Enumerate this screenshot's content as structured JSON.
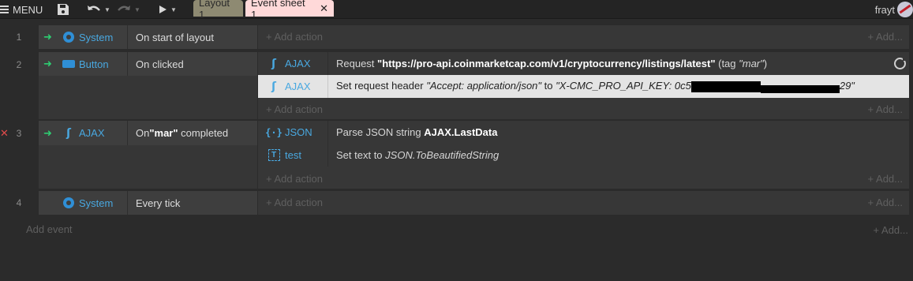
{
  "topbar": {
    "menu_label": "MENU",
    "tabs": [
      "Layout 1",
      "Event sheet 1"
    ],
    "close_glyph": "✕",
    "user_name": "frayt"
  },
  "sheet": {
    "add_action": "+ Add action",
    "add_more": "+ Add...",
    "add_event": "Add event",
    "events": [
      {
        "number": "1",
        "object": "System",
        "icon": "gear-icon",
        "condition": "On start of layout"
      },
      {
        "number": "2",
        "object": "Button",
        "icon": "button-icon",
        "condition": "On clicked",
        "actions": [
          {
            "object": "AJAX",
            "icon": "ajax-icon",
            "prefix": "Request ",
            "bold": "\"https://pro-api.coinmarketcap.com/v1/cryptocurrency/listings/latest\"",
            "middle": " (tag ",
            "italic": "\"mar\"",
            "suffix": ")"
          },
          {
            "object": "AJAX",
            "icon": "ajax-icon",
            "prefix": "Set request header ",
            "italic1": "\"Accept: application/json\"",
            "middle": " to ",
            "italic2_start": "\"X-CMC_PRO_API_KEY: 0c5",
            "italic2_end": "29\""
          }
        ]
      },
      {
        "number": "3",
        "object": "AJAX",
        "icon": "ajax-icon",
        "condition_prefix": "On ",
        "condition_bold": "\"mar\"",
        "condition_suffix": " completed",
        "actions": [
          {
            "object": "JSON",
            "icon": "json-icon",
            "prefix": "Parse JSON string ",
            "bold": "AJAX.LastData"
          },
          {
            "object": "test",
            "icon": "text-icon",
            "prefix": "Set text to ",
            "italic": "JSON.ToBeautifiedString"
          }
        ]
      },
      {
        "number": "4",
        "object": "System",
        "icon": "gear-icon",
        "condition": "Every tick"
      }
    ]
  }
}
